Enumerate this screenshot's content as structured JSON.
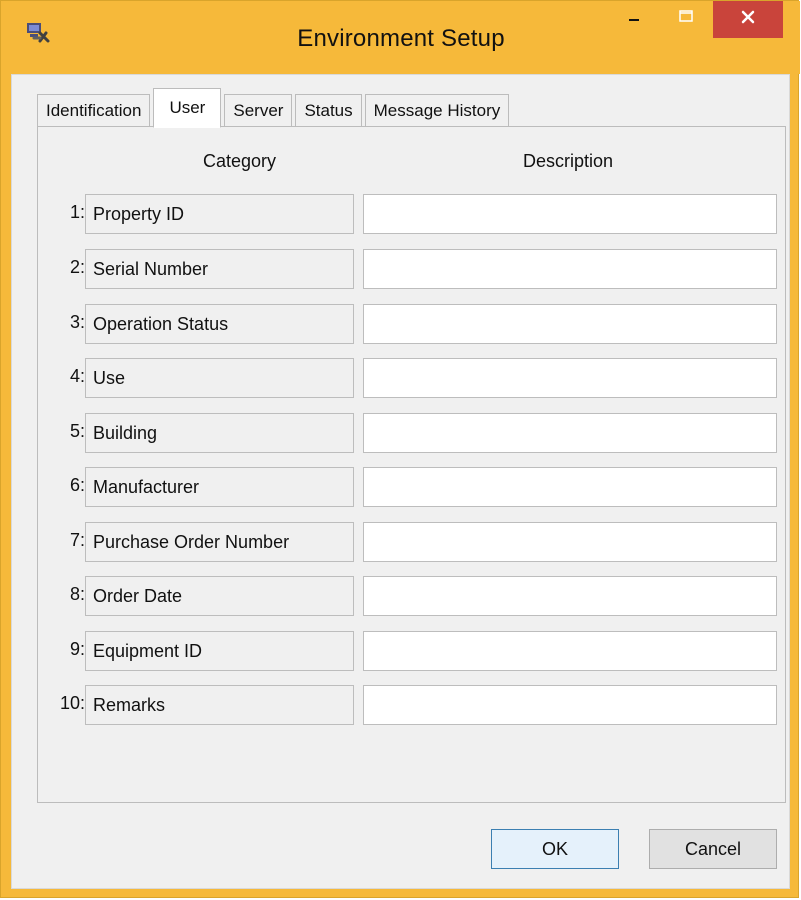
{
  "window": {
    "title": "Environment Setup",
    "icon": "environment-setup-icon",
    "controls": {
      "minimize_icon": "minimize-icon",
      "maximize_icon": "maximize-icon",
      "close_icon": "close-icon",
      "close_glyph": "×"
    },
    "colors": {
      "title_bar": "#f6b93a",
      "close_button": "#c9443b",
      "client_background": "#f0f0f0",
      "ok_button_border": "#3c7fb1"
    }
  },
  "tabs": [
    {
      "label": "Identification",
      "selected": false
    },
    {
      "label": "User",
      "selected": true
    },
    {
      "label": "Server",
      "selected": false
    },
    {
      "label": "Status",
      "selected": false
    },
    {
      "label": "Message History",
      "selected": false
    }
  ],
  "form": {
    "category_header": "Category",
    "description_header": "Description",
    "rows": [
      {
        "number": "1:",
        "category": "Property ID",
        "description": ""
      },
      {
        "number": "2:",
        "category": "Serial Number",
        "description": ""
      },
      {
        "number": "3:",
        "category": "Operation Status",
        "description": ""
      },
      {
        "number": "4:",
        "category": "Use",
        "description": ""
      },
      {
        "number": "5:",
        "category": "Building",
        "description": ""
      },
      {
        "number": "6:",
        "category": "Manufacturer",
        "description": ""
      },
      {
        "number": "7:",
        "category": "Purchase Order Number",
        "description": ""
      },
      {
        "number": "8:",
        "category": "Order Date",
        "description": ""
      },
      {
        "number": "9:",
        "category": "Equipment ID",
        "description": ""
      },
      {
        "number": "10:",
        "category": "Remarks",
        "description": ""
      }
    ]
  },
  "buttons": {
    "ok_label": "OK",
    "cancel_label": "Cancel"
  }
}
